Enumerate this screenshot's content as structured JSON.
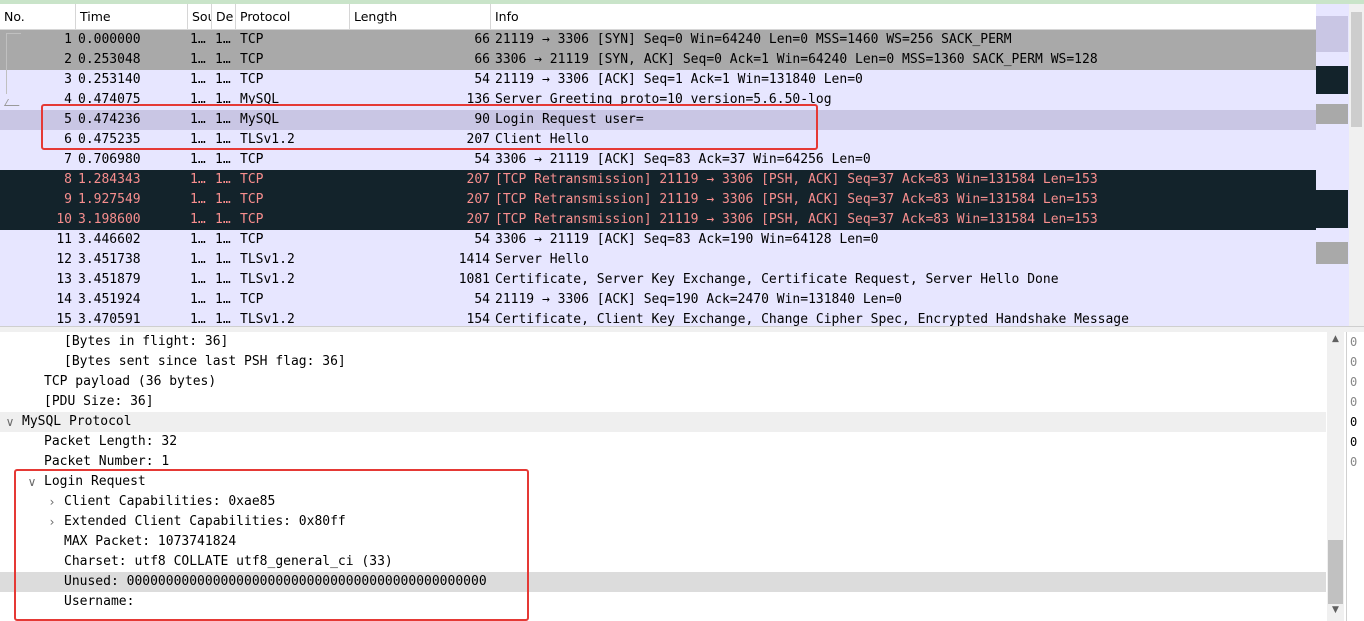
{
  "packet_list": {
    "columns": [
      "No.",
      "Time",
      "Sou",
      "De",
      "Protocol",
      "Length",
      "Info"
    ],
    "rows": [
      {
        "no": "1",
        "time": "0.000000",
        "src": "1…",
        "dst": "1…",
        "proto": "TCP",
        "len": "66",
        "info": "21119 → 3306 [SYN] Seq=0 Win=64240 Len=0 MSS=1460 WS=256 SACK_PERM",
        "style": "gray"
      },
      {
        "no": "2",
        "time": "0.253048",
        "src": "1…",
        "dst": "1…",
        "proto": "TCP",
        "len": "66",
        "info": "3306 → 21119 [SYN, ACK] Seq=0 Ack=1 Win=64240 Len=0 MSS=1360 SACK_PERM WS=128",
        "style": "gray"
      },
      {
        "no": "3",
        "time": "0.253140",
        "src": "1…",
        "dst": "1…",
        "proto": "TCP",
        "len": "54",
        "info": "21119 → 3306 [ACK] Seq=1 Ack=1 Win=131840 Len=0",
        "style": "lav"
      },
      {
        "no": "4",
        "time": "0.474075",
        "src": "1…",
        "dst": "1…",
        "proto": "MySQL",
        "len": "136",
        "info": "Server Greeting  proto=10 version=5.6.50-log",
        "style": "lav"
      },
      {
        "no": "5",
        "time": "0.474236",
        "src": "1…",
        "dst": "1…",
        "proto": "MySQL",
        "len": "90",
        "info": "Login Request user=",
        "style": "sel"
      },
      {
        "no": "6",
        "time": "0.475235",
        "src": "1…",
        "dst": "1…",
        "proto": "TLSv1.2",
        "len": "207",
        "info": "Client Hello",
        "style": "lav"
      },
      {
        "no": "7",
        "time": "0.706980",
        "src": "1…",
        "dst": "1…",
        "proto": "TCP",
        "len": "54",
        "info": "3306 → 21119 [ACK] Seq=83 Ack=37 Win=64256 Len=0",
        "style": "lav"
      },
      {
        "no": "8",
        "time": "1.284343",
        "src": "1…",
        "dst": "1…",
        "proto": "TCP",
        "len": "207",
        "info": "[TCP Retransmission] 21119 → 3306 [PSH, ACK] Seq=37 Ack=83 Win=131584 Len=153",
        "style": "dark"
      },
      {
        "no": "9",
        "time": "1.927549",
        "src": "1…",
        "dst": "1…",
        "proto": "TCP",
        "len": "207",
        "info": "[TCP Retransmission] 21119 → 3306 [PSH, ACK] Seq=37 Ack=83 Win=131584 Len=153",
        "style": "dark"
      },
      {
        "no": "10",
        "time": "3.198600",
        "src": "1…",
        "dst": "1…",
        "proto": "TCP",
        "len": "207",
        "info": "[TCP Retransmission] 21119 → 3306 [PSH, ACK] Seq=37 Ack=83 Win=131584 Len=153",
        "style": "dark"
      },
      {
        "no": "11",
        "time": "3.446602",
        "src": "1…",
        "dst": "1…",
        "proto": "TCP",
        "len": "54",
        "info": "3306 → 21119 [ACK] Seq=83 Ack=190 Win=64128 Len=0",
        "style": "lav"
      },
      {
        "no": "12",
        "time": "3.451738",
        "src": "1…",
        "dst": "1…",
        "proto": "TLSv1.2",
        "len": "1414",
        "info": "Server Hello",
        "style": "lav"
      },
      {
        "no": "13",
        "time": "3.451879",
        "src": "1…",
        "dst": "1…",
        "proto": "TLSv1.2",
        "len": "1081",
        "info": "Certificate, Server Key Exchange, Certificate Request, Server Hello Done",
        "style": "lav"
      },
      {
        "no": "14",
        "time": "3.451924",
        "src": "1…",
        "dst": "1…",
        "proto": "TCP",
        "len": "54",
        "info": "21119 → 3306 [ACK] Seq=190 Ack=2470 Win=131840 Len=0",
        "style": "lav"
      },
      {
        "no": "15",
        "time": "3.470591",
        "src": "1…",
        "dst": "1…",
        "proto": "TLSv1.2",
        "len": "154",
        "info": "Certificate, Client Key Exchange, Change Cipher Spec, Encrypted Handshake Message",
        "style": "lav"
      }
    ]
  },
  "details": {
    "lines": [
      {
        "text": "[Bytes in flight: 36]",
        "arrow": "",
        "kind": "normal"
      },
      {
        "text": "[Bytes sent since last PSH flag: 36]",
        "arrow": "",
        "kind": "normal"
      },
      {
        "text": "TCP payload (36 bytes)",
        "arrow": "",
        "kind": "normal"
      },
      {
        "text": "[PDU Size: 36]",
        "arrow": "",
        "kind": "normal"
      },
      {
        "text": "MySQL Protocol",
        "arrow": "∨",
        "kind": "sect"
      },
      {
        "text": "Packet Length: 32",
        "arrow": "",
        "kind": "normal"
      },
      {
        "text": "Packet Number: 1",
        "arrow": "",
        "kind": "normal"
      },
      {
        "text": "Login Request",
        "arrow": "∨",
        "kind": "normal"
      },
      {
        "text": "Client Capabilities: 0xae85",
        "arrow": "›",
        "kind": "normal"
      },
      {
        "text": "Extended Client Capabilities: 0x80ff",
        "arrow": "›",
        "kind": "normal"
      },
      {
        "text": "MAX Packet: 1073741824",
        "arrow": "",
        "kind": "normal"
      },
      {
        "text": "Charset: utf8 COLLATE utf8_general_ci (33)",
        "arrow": "",
        "kind": "normal"
      },
      {
        "text": "Unused: 0000000000000000000000000000000000000000000000",
        "arrow": "",
        "kind": "sel"
      },
      {
        "text": "Username: ",
        "arrow": "",
        "kind": "normal"
      }
    ]
  },
  "bytes_pane": [
    "0",
    "0",
    "0",
    "0",
    "0",
    "0",
    "0"
  ],
  "colors": {
    "gray": "#a9a9a9",
    "lavender": "#e7e6ff",
    "selected": "#c9c6e4",
    "dark": "#13232b",
    "dark_text": "#f78e8e",
    "highlight_box": "#e53935"
  },
  "icons": {
    "scroll_up": "▲",
    "scroll_down": "▼"
  }
}
